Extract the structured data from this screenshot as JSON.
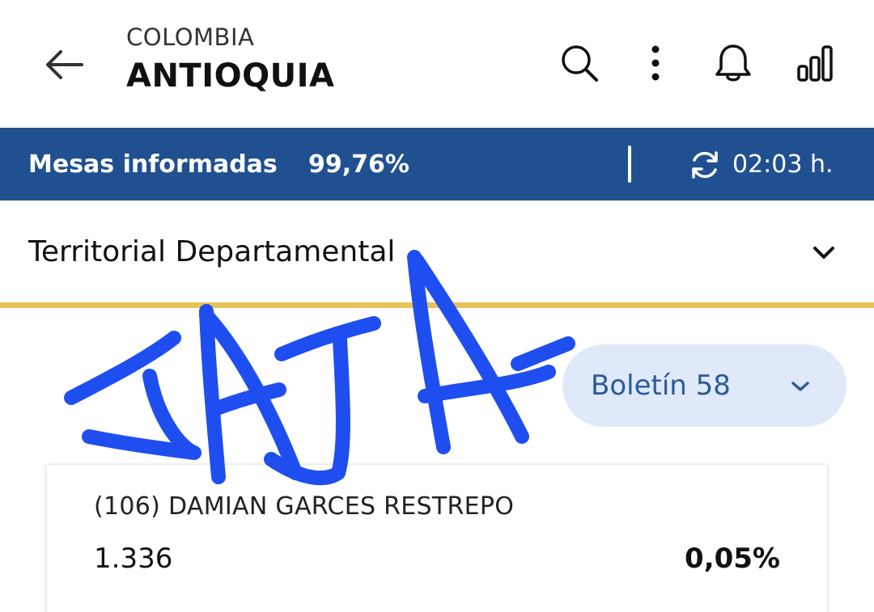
{
  "header": {
    "country": "COLOMBIA",
    "region": "ANTIOQUIA",
    "icons": {
      "back": "arrow-left-icon",
      "search": "search-icon",
      "more": "more-vertical-icon",
      "notifications": "bell-icon",
      "stats": "signal-bars-icon"
    }
  },
  "status_bar": {
    "label": "Mesas informadas",
    "value": "99,76%",
    "time": "02:03 h.",
    "icon": "refresh-icon",
    "background_color": "#20508f"
  },
  "election_selector": {
    "selected": "Territorial Departamental",
    "icon": "chevron-down-icon",
    "accent_color": "#e8c35a"
  },
  "bulletin_selector": {
    "selected": "Boletín 58",
    "icon": "chevron-down-icon",
    "background_color": "#dfe9fa",
    "text_color": "#2b5a98"
  },
  "results": [
    {
      "name": "(106) DAMIAN GARCES RESTREPO",
      "votes": "1.336",
      "percentage": "0,05%"
    }
  ],
  "overlay": {
    "handwritten_text": "JAJA",
    "color": "#1f4ef0"
  }
}
